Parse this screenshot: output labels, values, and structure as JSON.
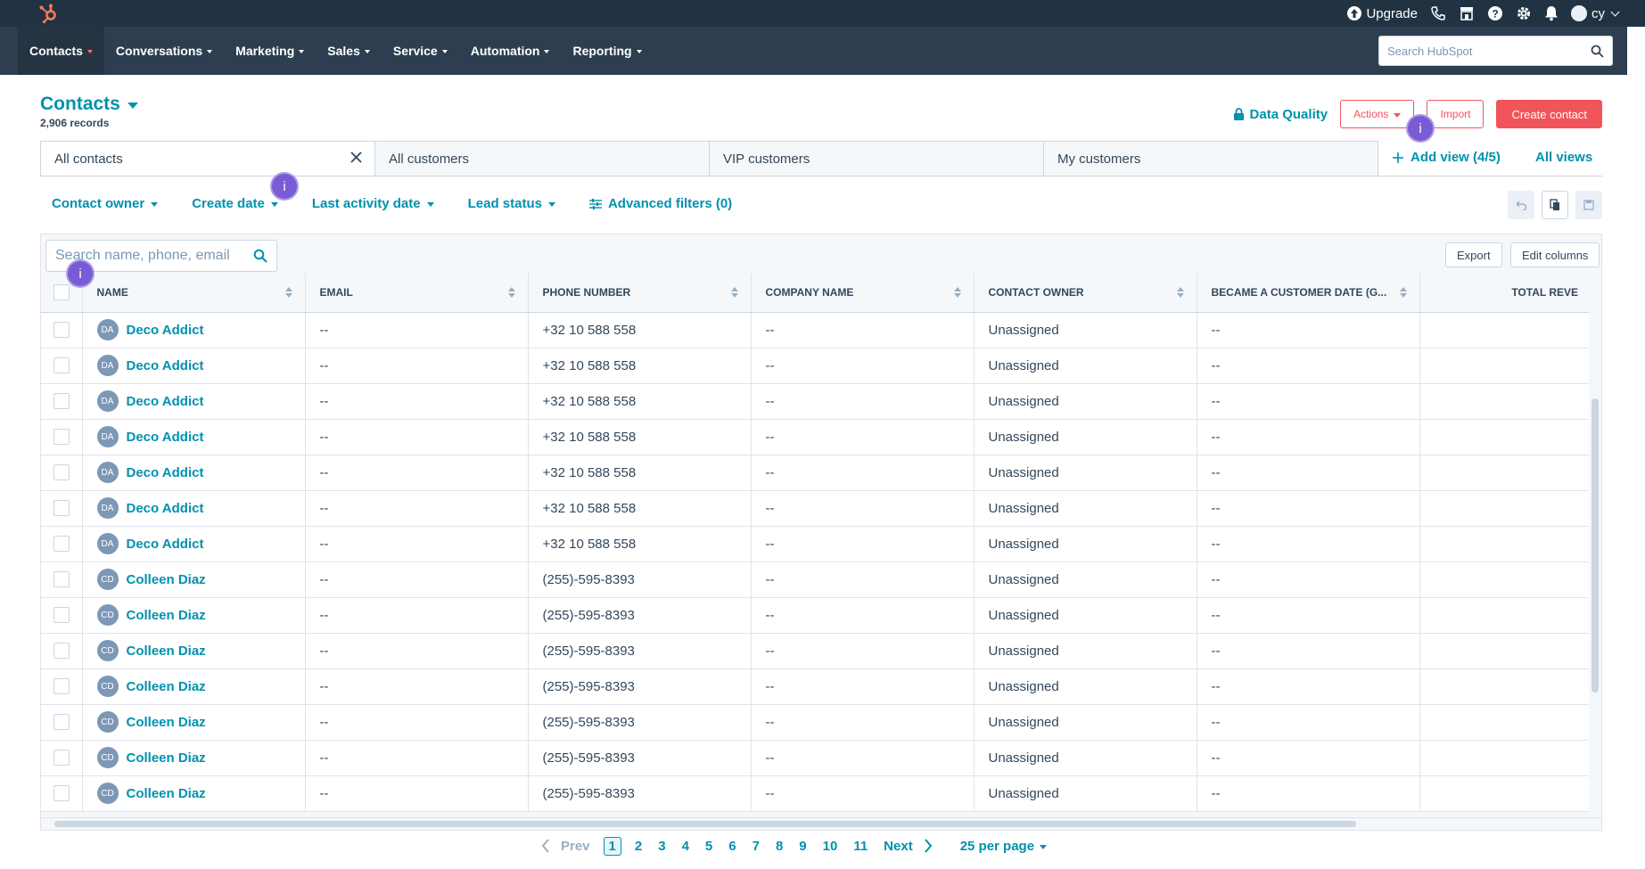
{
  "top_bar": {
    "upgrade_label": "Upgrade",
    "user_initials": "cy",
    "icons": [
      "hubspot-logo",
      "upgrade-icon",
      "calling-icon",
      "marketplace-icon",
      "help-icon",
      "settings-icon",
      "notifications-icon",
      "avatar"
    ]
  },
  "nav": {
    "items": [
      {
        "label": "Contacts",
        "active": true
      },
      {
        "label": "Conversations"
      },
      {
        "label": "Marketing"
      },
      {
        "label": "Sales"
      },
      {
        "label": "Service"
      },
      {
        "label": "Automation"
      },
      {
        "label": "Reporting"
      }
    ],
    "search_placeholder": "Search HubSpot"
  },
  "header": {
    "title": "Contacts",
    "records": "2,906 records",
    "data_quality": "Data Quality",
    "actions": "Actions",
    "import": "Import",
    "create": "Create contact"
  },
  "tabs": {
    "items": [
      "All contacts",
      "All customers",
      "VIP customers",
      "My customers"
    ],
    "active_index": 0,
    "add_view": "Add view (4/5)",
    "all_views": "All views"
  },
  "filters": {
    "contact_owner": "Contact owner",
    "create_date": "Create date",
    "last_activity": "Last activity date",
    "lead_status": "Lead status",
    "advanced": "Advanced filters (0)"
  },
  "table": {
    "search_placeholder": "Search name, phone, email",
    "export": "Export",
    "edit_columns": "Edit columns",
    "columns": [
      "NAME",
      "EMAIL",
      "PHONE NUMBER",
      "COMPANY NAME",
      "CONTACT OWNER",
      "BECAME A CUSTOMER DATE (G...",
      "TOTAL REVE"
    ],
    "rows": [
      {
        "initials": "DA",
        "name": "Deco Addict",
        "email": "--",
        "phone": "+32 10 588 558",
        "company": "--",
        "owner": "Unassigned",
        "customer_date": "--",
        "revenue": ""
      },
      {
        "initials": "DA",
        "name": "Deco Addict",
        "email": "--",
        "phone": "+32 10 588 558",
        "company": "--",
        "owner": "Unassigned",
        "customer_date": "--",
        "revenue": ""
      },
      {
        "initials": "DA",
        "name": "Deco Addict",
        "email": "--",
        "phone": "+32 10 588 558",
        "company": "--",
        "owner": "Unassigned",
        "customer_date": "--",
        "revenue": ""
      },
      {
        "initials": "DA",
        "name": "Deco Addict",
        "email": "--",
        "phone": "+32 10 588 558",
        "company": "--",
        "owner": "Unassigned",
        "customer_date": "--",
        "revenue": ""
      },
      {
        "initials": "DA",
        "name": "Deco Addict",
        "email": "--",
        "phone": "+32 10 588 558",
        "company": "--",
        "owner": "Unassigned",
        "customer_date": "--",
        "revenue": ""
      },
      {
        "initials": "DA",
        "name": "Deco Addict",
        "email": "--",
        "phone": "+32 10 588 558",
        "company": "--",
        "owner": "Unassigned",
        "customer_date": "--",
        "revenue": ""
      },
      {
        "initials": "DA",
        "name": "Deco Addict",
        "email": "--",
        "phone": "+32 10 588 558",
        "company": "--",
        "owner": "Unassigned",
        "customer_date": "--",
        "revenue": ""
      },
      {
        "initials": "CD",
        "name": "Colleen Diaz",
        "email": "--",
        "phone": "(255)-595-8393",
        "company": "--",
        "owner": "Unassigned",
        "customer_date": "--",
        "revenue": ""
      },
      {
        "initials": "CD",
        "name": "Colleen Diaz",
        "email": "--",
        "phone": "(255)-595-8393",
        "company": "--",
        "owner": "Unassigned",
        "customer_date": "--",
        "revenue": ""
      },
      {
        "initials": "CD",
        "name": "Colleen Diaz",
        "email": "--",
        "phone": "(255)-595-8393",
        "company": "--",
        "owner": "Unassigned",
        "customer_date": "--",
        "revenue": ""
      },
      {
        "initials": "CD",
        "name": "Colleen Diaz",
        "email": "--",
        "phone": "(255)-595-8393",
        "company": "--",
        "owner": "Unassigned",
        "customer_date": "--",
        "revenue": ""
      },
      {
        "initials": "CD",
        "name": "Colleen Diaz",
        "email": "--",
        "phone": "(255)-595-8393",
        "company": "--",
        "owner": "Unassigned",
        "customer_date": "--",
        "revenue": ""
      },
      {
        "initials": "CD",
        "name": "Colleen Diaz",
        "email": "--",
        "phone": "(255)-595-8393",
        "company": "--",
        "owner": "Unassigned",
        "customer_date": "--",
        "revenue": ""
      },
      {
        "initials": "CD",
        "name": "Colleen Diaz",
        "email": "--",
        "phone": "(255)-595-8393",
        "company": "--",
        "owner": "Unassigned",
        "customer_date": "--",
        "revenue": ""
      }
    ]
  },
  "pagination": {
    "prev": "Prev",
    "next": "Next",
    "pages": [
      "1",
      "2",
      "3",
      "4",
      "5",
      "6",
      "7",
      "8",
      "9",
      "10",
      "11"
    ],
    "current": "1",
    "per_page": "25 per page"
  },
  "info_marker": "i",
  "colors": {
    "topbar": "#213343",
    "navbar": "#2d3e50",
    "link": "#0091ae",
    "accent": "#f2545b",
    "info_marker": "#7a5bd6"
  }
}
